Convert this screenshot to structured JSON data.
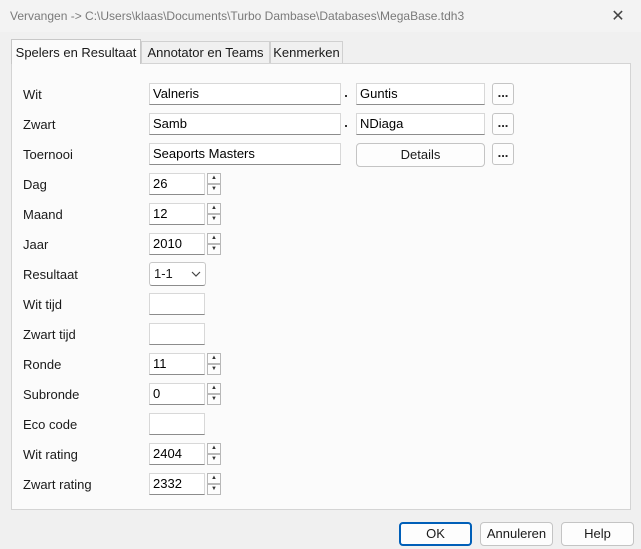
{
  "window": {
    "title": "Vervangen -> C:\\Users\\klaas\\Documents\\Turbo Dambase\\Databases\\MegaBase.tdh3",
    "close_glyph": "✕"
  },
  "tabs": [
    {
      "label": "Spelers en Resultaat",
      "active": true
    },
    {
      "label": "Annotator en Teams",
      "active": false
    },
    {
      "label": "Kenmerken",
      "active": false
    }
  ],
  "form": {
    "wit": {
      "label": "Wit",
      "first": "Valneris",
      "last": "Guntis"
    },
    "zwart": {
      "label": "Zwart",
      "first": "Samb",
      "last": "NDiaga"
    },
    "toernooi": {
      "label": "Toernooi",
      "value": "Seaports Masters",
      "details_label": "Details"
    },
    "dag": {
      "label": "Dag",
      "value": "26"
    },
    "maand": {
      "label": "Maand",
      "value": "12"
    },
    "jaar": {
      "label": "Jaar",
      "value": "2010"
    },
    "resultaat": {
      "label": "Resultaat",
      "value": "1-1"
    },
    "wit_tijd": {
      "label": "Wit tijd",
      "value": ""
    },
    "zwart_tijd": {
      "label": "Zwart tijd",
      "value": ""
    },
    "ronde": {
      "label": "Ronde",
      "value": "11"
    },
    "subronde": {
      "label": "Subronde",
      "value": "0"
    },
    "eco_code": {
      "label": "Eco code",
      "value": ""
    },
    "wit_rating": {
      "label": "Wit rating",
      "value": "2404"
    },
    "zwart_rating": {
      "label": "Zwart rating",
      "value": "2332"
    },
    "ellipsis": "..."
  },
  "footer": {
    "ok_label": "OK",
    "cancel_label": "Annuleren",
    "help_label": "Help"
  },
  "colors": {
    "accent": "#005fb8",
    "panel": "#fbfbfb",
    "background": "#f0f0f0"
  }
}
